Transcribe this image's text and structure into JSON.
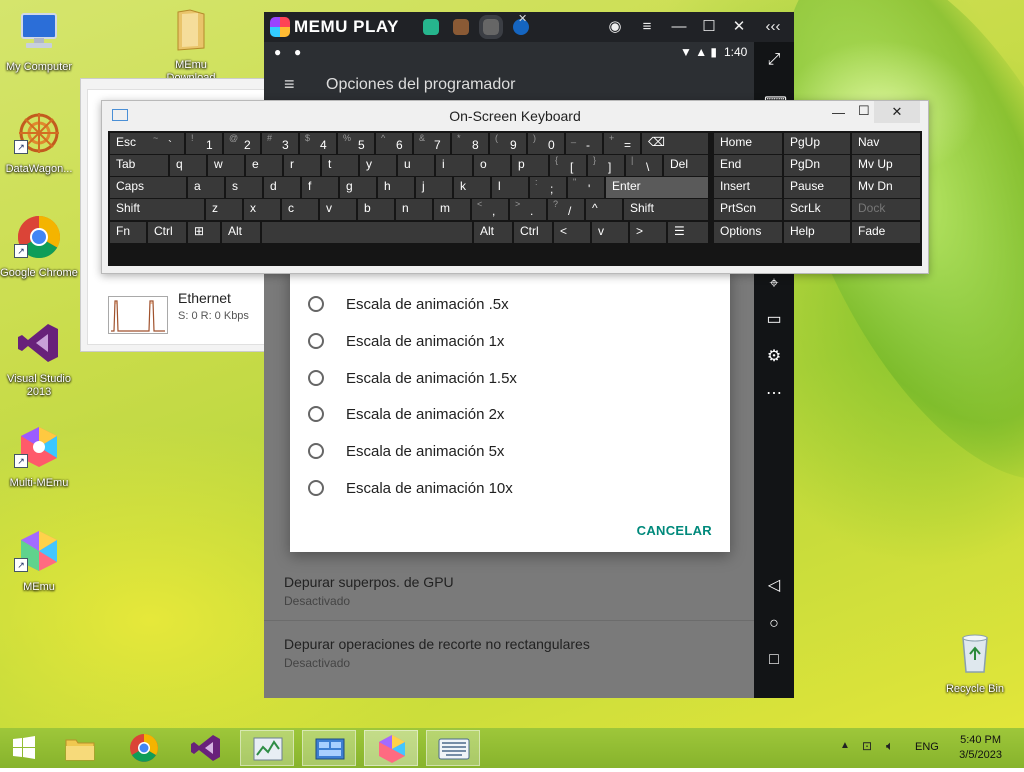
{
  "desktop": {
    "icons": [
      {
        "label": "My Computer"
      },
      {
        "label": "MEmu Download"
      },
      {
        "label": "DataWagon..."
      },
      {
        "label": "Google Chrome"
      },
      {
        "label": "Visual Studio 2013"
      },
      {
        "label": "Multi-MEmu"
      },
      {
        "label": "MEmu"
      },
      {
        "label": "Recycle Bin"
      }
    ]
  },
  "taskmgr": {
    "ethernet_title": "Ethernet",
    "ethernet_stats": "S: 0  R: 0 Kbps"
  },
  "memu": {
    "brand": "MEMU PLAY",
    "status_time": "1:40",
    "appbar_title": "Opciones del programador",
    "bg_rows": [
      {
        "title": "Depurar superpos. de GPU",
        "sub": "Desactivado"
      },
      {
        "title": "Depurar operaciones de recorte no rectangulares",
        "sub": "Desactivado"
      }
    ],
    "dialog": {
      "options": [
        "Escala de animación .5x",
        "Escala de animación 1x",
        "Escala de animación 1.5x",
        "Escala de animación 2x",
        "Escala de animación 5x",
        "Escala de animación 10x"
      ],
      "cancel": "CANCELAR"
    }
  },
  "osk": {
    "title": "On-Screen Keyboard",
    "row1": [
      {
        "label": "Esc"
      },
      {
        "sub": "~",
        "main": "`"
      },
      {
        "sub": "!",
        "main": "1"
      },
      {
        "sub": "@",
        "main": "2"
      },
      {
        "sub": "#",
        "main": "3"
      },
      {
        "sub": "$",
        "main": "4"
      },
      {
        "sub": "%",
        "main": "5"
      },
      {
        "sub": "^",
        "main": "6"
      },
      {
        "sub": "&",
        "main": "7"
      },
      {
        "sub": "*",
        "main": "8"
      },
      {
        "sub": "(",
        "main": "9"
      },
      {
        "sub": ")",
        "main": "0"
      },
      {
        "sub": "_",
        "main": "-"
      },
      {
        "sub": "+",
        "main": "="
      },
      {
        "label": "⌫"
      }
    ],
    "row2": [
      {
        "label": "Tab"
      },
      {
        "label": "q"
      },
      {
        "label": "w"
      },
      {
        "label": "e"
      },
      {
        "label": "r"
      },
      {
        "label": "t"
      },
      {
        "label": "y"
      },
      {
        "label": "u"
      },
      {
        "label": "i"
      },
      {
        "label": "o"
      },
      {
        "label": "p"
      },
      {
        "sub": "{",
        "main": "["
      },
      {
        "sub": "}",
        "main": "]"
      },
      {
        "sub": "|",
        "main": "\\"
      },
      {
        "label": "Del"
      }
    ],
    "row3": [
      {
        "label": "Caps"
      },
      {
        "label": "a"
      },
      {
        "label": "s"
      },
      {
        "label": "d"
      },
      {
        "label": "f"
      },
      {
        "label": "g"
      },
      {
        "label": "h"
      },
      {
        "label": "j"
      },
      {
        "label": "k"
      },
      {
        "label": "l"
      },
      {
        "sub": ":",
        "main": ";"
      },
      {
        "sub": "\"",
        "main": "'"
      },
      {
        "label": "Enter"
      }
    ],
    "row4": [
      {
        "label": "Shift"
      },
      {
        "label": "z"
      },
      {
        "label": "x"
      },
      {
        "label": "c"
      },
      {
        "label": "v"
      },
      {
        "label": "b"
      },
      {
        "label": "n"
      },
      {
        "label": "m"
      },
      {
        "sub": "<",
        "main": ","
      },
      {
        "sub": ">",
        "main": "."
      },
      {
        "sub": "?",
        "main": "/"
      },
      {
        "label": "^"
      },
      {
        "label": "Shift"
      }
    ],
    "row5": [
      {
        "label": "Fn"
      },
      {
        "label": "Ctrl"
      },
      {
        "label": "⊞"
      },
      {
        "label": "Alt"
      },
      {
        "label": ""
      },
      {
        "label": "Alt"
      },
      {
        "label": "Ctrl"
      },
      {
        "label": "<"
      },
      {
        "label": "v"
      },
      {
        "label": ">"
      },
      {
        "label": "☰"
      }
    ],
    "nav": [
      [
        "Home",
        "PgUp",
        "Nav"
      ],
      [
        "End",
        "PgDn",
        "Mv Up"
      ],
      [
        "Insert",
        "Pause",
        "Mv Dn"
      ],
      [
        "PrtScn",
        "ScrLk",
        "Dock"
      ],
      [
        "Options",
        "Help",
        "Fade"
      ]
    ]
  },
  "tray": {
    "lang": "ENG",
    "time": "5:40 PM",
    "date": "3/5/2023"
  }
}
